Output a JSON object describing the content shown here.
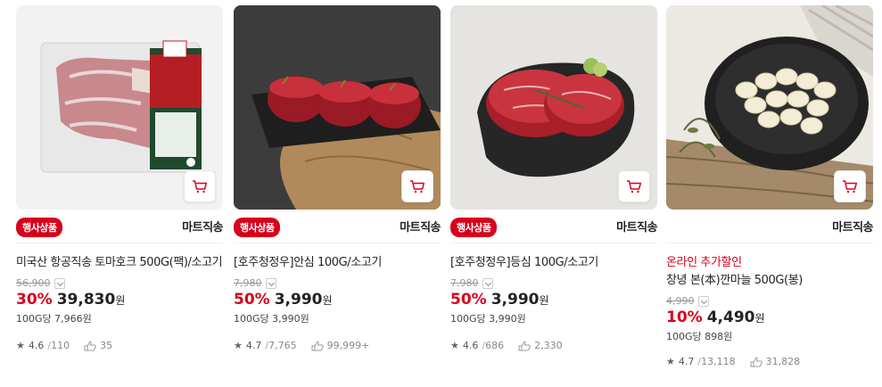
{
  "colors": {
    "accent": "#d8001b"
  },
  "products": [
    {
      "image": "usda-tomahawk-steak-package",
      "event_badge": "행사상품",
      "direct_label": "마트직송",
      "promo": "",
      "title": "미국산 항공직송 토마호크 500G(팩)/소고기",
      "orig_price": "56,900",
      "rate": "30%",
      "price": "39,830",
      "won": "원",
      "unit_price": "100G당 7,966원",
      "rating": "4.6",
      "reviews": "110",
      "sold": "35"
    },
    {
      "image": "tenderloin-steaks-on-slate",
      "event_badge": "행사상품",
      "direct_label": "마트직송",
      "promo": "",
      "title": "[호주청정우]안심 100G/소고기",
      "orig_price": "7,980",
      "rate": "50%",
      "price": "3,990",
      "won": "원",
      "unit_price": "100G당 3,990원",
      "rating": "4.7",
      "reviews": "7,765",
      "sold": "99,999+"
    },
    {
      "image": "ribeye-steaks-on-slate",
      "event_badge": "행사상품",
      "direct_label": "마트직송",
      "promo": "",
      "title": "[호주청정우]등심 100G/소고기",
      "orig_price": "7,980",
      "rate": "50%",
      "price": "3,990",
      "won": "원",
      "unit_price": "100G당 3,990원",
      "rating": "4.6",
      "reviews": "686",
      "sold": "2,330"
    },
    {
      "image": "peeled-garlic-bowl",
      "event_badge": "",
      "direct_label": "마트직송",
      "promo": "온라인 추가할인",
      "title": "창녕 본(本)깐마늘 500G(봉)",
      "orig_price": "4,990",
      "rate": "10%",
      "price": "4,490",
      "won": "원",
      "unit_price": "100G당 898원",
      "rating": "4.7",
      "reviews": "13,118",
      "sold": "31,828"
    }
  ]
}
